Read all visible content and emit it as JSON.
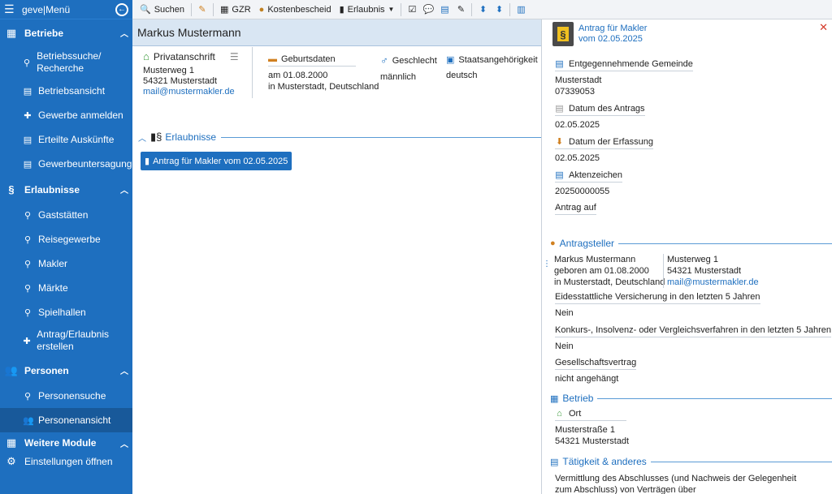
{
  "sidebar": {
    "app_title": "geve|Menü",
    "sections": {
      "betriebe": {
        "label": "Betriebe"
      },
      "erlaubnisse": {
        "label": "Erlaubnisse"
      },
      "personen": {
        "label": "Personen"
      },
      "weitere": {
        "label": "Weitere Module"
      }
    },
    "items": {
      "betriebssuche": "Betriebssuche/ Recherche",
      "betriebsansicht": "Betriebsansicht",
      "gewerbe_anmelden": "Gewerbe anmelden",
      "auskuenfte": "Erteilte Auskünfte",
      "gewerbeuntersagung": "Gewerbeuntersagung",
      "gaststaetten": "Gaststätten",
      "reisegewerbe": "Reisegewerbe",
      "makler": "Makler",
      "maerkte": "Märkte",
      "spielhallen": "Spielhallen",
      "antrag_erstellen": "Antrag/Erlaubnis erstellen",
      "personensuche": "Personensuche",
      "personenansicht": "Personenansicht",
      "einstellungen": "Einstellungen öffnen"
    }
  },
  "toolbar": {
    "suchen": "Suchen",
    "gzr": "GZR",
    "kostenbescheid": "Kostenbescheid",
    "erlaubnis": "Erlaubnis"
  },
  "person": {
    "name": "Markus Mustermann",
    "privatanschrift_label": "Privatanschrift",
    "street": "Musterweg 1",
    "city": "54321 Musterstadt",
    "email": "mail@mustermakler.de",
    "geburtsdaten_label": "Geburtsdaten",
    "geburtsdatum": "am 01.08.2000",
    "geburtsort": "in Musterstadt, Deutschland",
    "geschlecht_label": "Geschlecht",
    "geschlecht": "männlich",
    "staat_label": "Staatsangehörigkeit",
    "staat": "deutsch"
  },
  "erlaubnisse": {
    "label": "Erlaubnisse",
    "entry": "Antrag für Makler vom 02.05.2025"
  },
  "panel": {
    "title_line1": "Antrag für Makler",
    "title_line2": "vom 02.05.2025",
    "gemeinde_label": "Entgegennehmende Gemeinde",
    "gemeinde": "Musterstadt",
    "gemeinde_code": "07339053",
    "datum_antrag_label": "Datum des Antrags",
    "datum_antrag": "02.05.2025",
    "datum_erfassung_label": "Datum der Erfassung",
    "datum_erfassung": "02.05.2025",
    "aktenzeichen_label": "Aktenzeichen",
    "aktenzeichen": "20250000055",
    "antrag_auf_label": "Antrag auf",
    "antragsteller_label": "Antragsteller",
    "ast_name": "Markus Mustermann",
    "ast_geboren": "geboren am 01.08.2000",
    "ast_ort": "in Musterstadt, Deutschland",
    "ast_street": "Musterweg 1",
    "ast_city": "54321 Musterstadt",
    "ast_email": "mail@mustermakler.de",
    "eid_label": "Eidesstattliche Versicherung in den letzten 5 Jahren",
    "eid": "Nein",
    "konkurs_label": "Konkurs-, Insolvenz- oder Vergleichsverfahren in den letzten 5 Jahren",
    "konkurs": "Nein",
    "gesellschaft_label": "Gesellschaftsvertrag",
    "gesellschaft": "nicht angehängt",
    "betrieb_label": "Betrieb",
    "ort_label": "Ort",
    "ort_street": "Musterstraße 1",
    "ort_city": "54321 Musterstadt",
    "taetigkeit_label": "Tätigkeit & anderes",
    "taetigkeit_text": "Vermittlung des Abschlusses (und Nachweis der Gelegenheit zum Abschluss) von Verträgen über"
  }
}
